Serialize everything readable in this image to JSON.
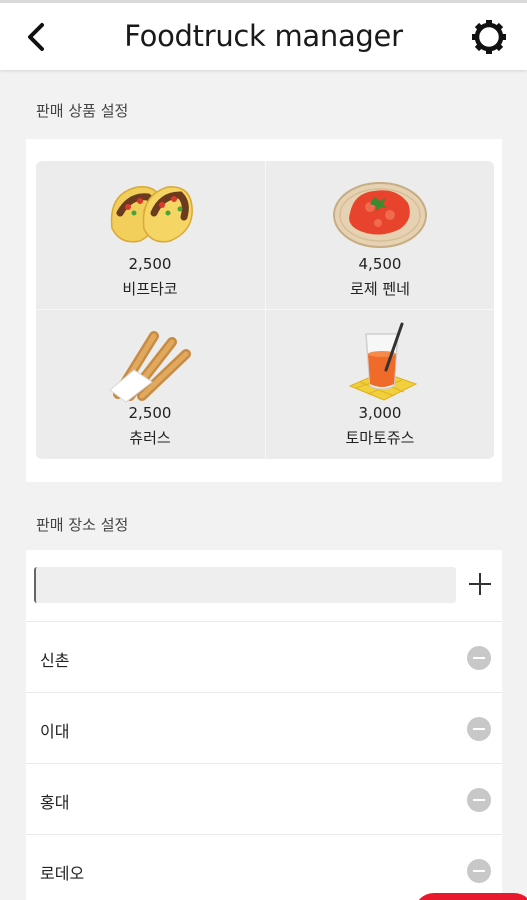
{
  "header": {
    "title": "Foodtruck manager",
    "back_icon": "back-arrow-icon",
    "settings_icon": "gear-icon"
  },
  "products_section": {
    "label": "판매 상품 설정",
    "items": [
      {
        "price": "2,500",
        "name": "비프타코",
        "icon": "taco-icon"
      },
      {
        "price": "4,500",
        "name": "로제 펜네",
        "icon": "pasta-icon"
      },
      {
        "price": "2,500",
        "name": "츄러스",
        "icon": "churros-icon"
      },
      {
        "price": "3,000",
        "name": "토마토쥬스",
        "icon": "tomato-juice-icon"
      }
    ]
  },
  "locations_section": {
    "label": "판매 장소 설정",
    "input_value": "",
    "add_icon": "plus-icon",
    "items": [
      {
        "name": "신촌",
        "icon": "remove-icon"
      },
      {
        "name": "이대",
        "icon": "remove-icon"
      },
      {
        "name": "홍대",
        "icon": "remove-icon"
      },
      {
        "name": "로데오",
        "icon": "remove-icon"
      }
    ]
  },
  "colors": {
    "background": "#f2f2f2",
    "card": "#ffffff",
    "grid": "#ececec",
    "accent": "#e8192c",
    "remove_button": "#c8c8c8"
  }
}
